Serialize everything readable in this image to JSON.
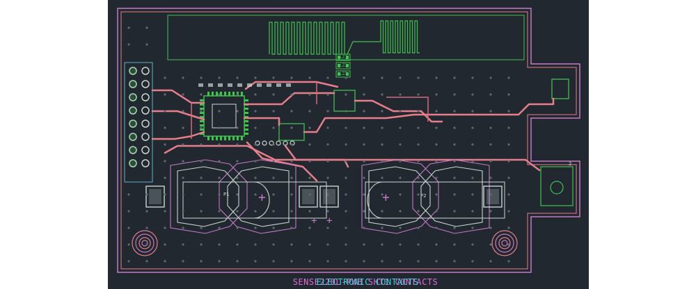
{
  "window": {
    "background": "#ffffff",
    "canvas_background": "#212830"
  },
  "colors": {
    "edge": "#c878c8",
    "copper_top": "#e87f8a",
    "copper_fill": "#d66a79",
    "silk": "#3fc44d",
    "pad": "#c9d8cf",
    "drill": "#5e6a74",
    "outline_cyan": "#5fb5c8",
    "label_cyan": "#3fd3d8",
    "label_magenta": "#e06ad8"
  },
  "board": {
    "labels": {
      "battery_left": "P1",
      "battery_right": "P2",
      "corner": "2",
      "plus_left": "+",
      "plus_right": "+",
      "plus_mid_a": "+",
      "plus_mid_b": "+"
    },
    "chip_labels": [
      "LZ1",
      "LZ2",
      "LZ3"
    ],
    "title_a": "SENSE220L-PWB  SHT1 CONTACTS",
    "title_b": "ELECTRONIC CONTACTS"
  }
}
